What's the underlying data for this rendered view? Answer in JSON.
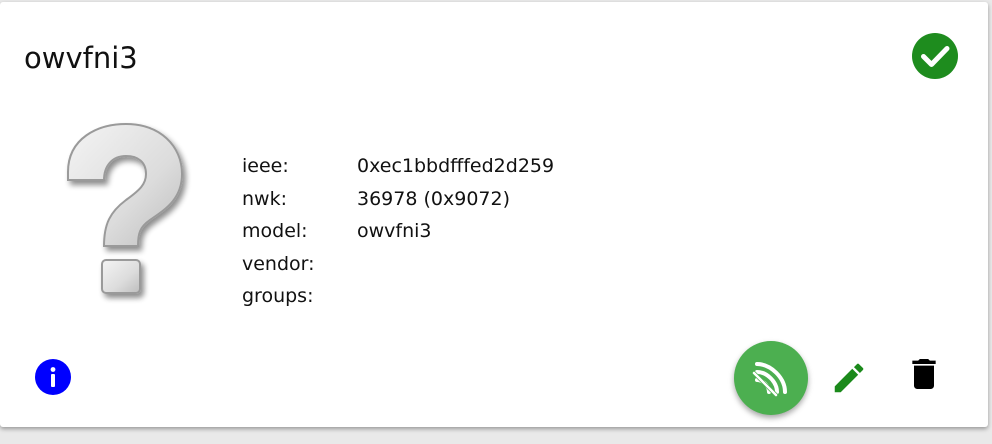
{
  "device": {
    "title": "owvfni3",
    "status_icon": "check-circle-icon",
    "image_icon": "question-mark-icon",
    "details": [
      {
        "key": "ieee:",
        "value": "0xec1bbdfffed2d259"
      },
      {
        "key": "nwk:",
        "value": "36978 (0x9072)"
      },
      {
        "key": "model:",
        "value": "owvfni3"
      },
      {
        "key": "vendor:",
        "value": ""
      },
      {
        "key": "groups:",
        "value": ""
      }
    ]
  },
  "actions": {
    "info_icon": "info-icon",
    "signal_icon": "wifi-signal-icon",
    "edit_icon": "pencil-icon",
    "delete_icon": "trash-icon"
  },
  "colors": {
    "status_green": "#1e8c1e",
    "fab_green": "#4caf50",
    "edit_green": "#1b8a1b",
    "info_blue": "#0000ff",
    "delete_black": "#000000"
  }
}
